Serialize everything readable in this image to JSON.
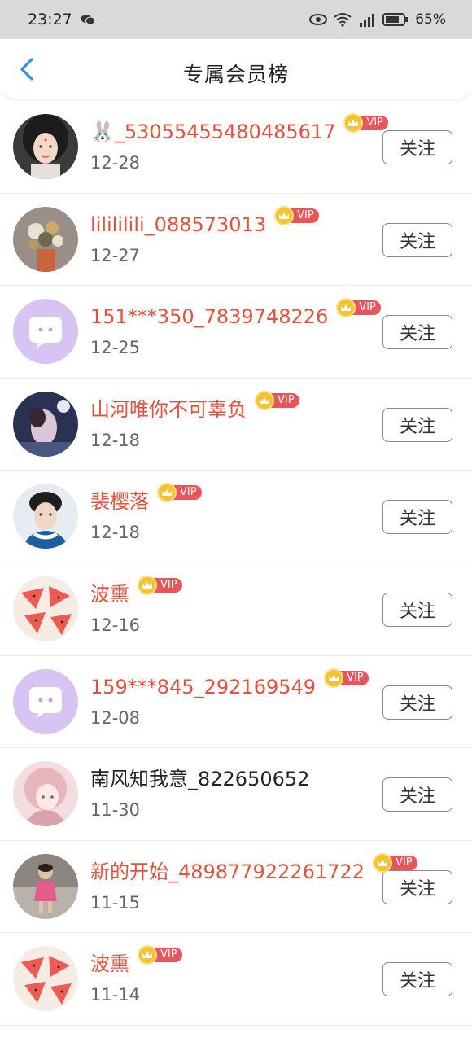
{
  "status_bar": {
    "time": "23:27",
    "battery": "65%",
    "icons": [
      "wechat-icon",
      "eye-icon",
      "wifi-icon",
      "signal-icon",
      "battery-icon"
    ]
  },
  "nav": {
    "title": "专属会员榜",
    "back_icon": "chevron-left-icon"
  },
  "vip_label": "VIP",
  "follow_label": "关注",
  "members": [
    {
      "name": "🐰_53055455480485617",
      "date": "12-28",
      "vip": true,
      "avatar": "portrait-woman"
    },
    {
      "name": "lilililili_088573013",
      "date": "12-27",
      "vip": true,
      "avatar": "flowers"
    },
    {
      "name": "151***350_7839748226",
      "date": "12-25",
      "vip": true,
      "avatar": "default-chat"
    },
    {
      "name": "山河唯你不可辜负",
      "date": "12-18",
      "vip": true,
      "avatar": "anime-night"
    },
    {
      "name": "裴樱落",
      "date": "12-18",
      "vip": true,
      "avatar": "portrait-man"
    },
    {
      "name": "波熏",
      "date": "12-16",
      "vip": true,
      "avatar": "watermelon"
    },
    {
      "name": "159***845_292169549",
      "date": "12-08",
      "vip": true,
      "avatar": "default-chat"
    },
    {
      "name": "南风知我意_822650652",
      "date": "11-30",
      "vip": false,
      "avatar": "anime-girl"
    },
    {
      "name": "新的开始_489877922261722",
      "date": "11-15",
      "vip": true,
      "avatar": "child"
    },
    {
      "name": "波熏",
      "date": "11-14",
      "vip": true,
      "avatar": "watermelon"
    }
  ],
  "colors": {
    "vip_name": "#e9503c",
    "normal_name": "#222222",
    "vip_tag": "#e8555a",
    "crown": "#f5c230",
    "default_avatar": "#d7c4f2"
  }
}
